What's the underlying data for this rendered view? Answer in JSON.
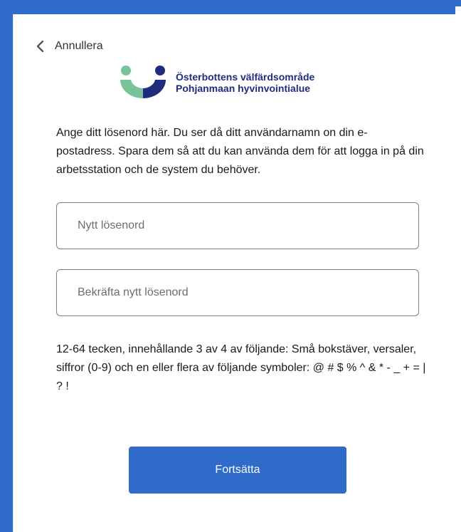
{
  "nav": {
    "back_label": "Annullera"
  },
  "brand": {
    "line1": "Österbottens välfärdsområde",
    "line2": "Pohjanmaan hyvinvointialue",
    "colors": {
      "green": "#78c39a",
      "navy": "#1f2d7e"
    }
  },
  "intro": {
    "text": "Ange ditt lösenord här. Du ser då ditt användarnamn on din e-postadress. Spara dem så att du kan använda dem för att logga in på din arbetsstation och de system du behöver."
  },
  "form": {
    "new_password_placeholder": "Nytt lösenord",
    "confirm_password_placeholder": "Bekräfta nytt lösenord"
  },
  "requirements": {
    "text": "12-64 tecken, innehållande 3 av 4 av följande: Små bokstäver, versaler, siffror (0-9) och en eller flera av följande symboler: @ # $ % ^ & * - _ + = | ? !"
  },
  "actions": {
    "continue_label": "Fortsätta"
  },
  "theme": {
    "accent": "#2f6bc8"
  }
}
